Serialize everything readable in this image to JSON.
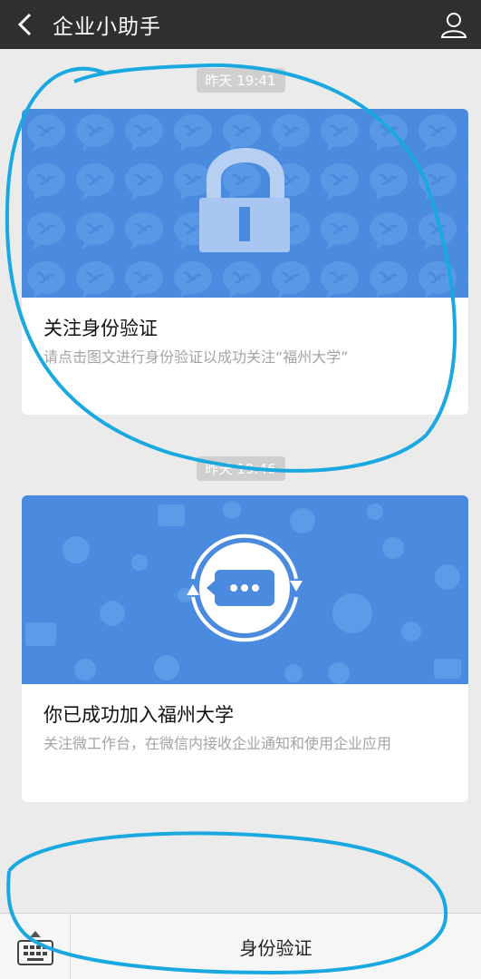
{
  "header": {
    "title": "企业小助手",
    "back_icon": "chevron-left-icon",
    "profile_icon": "person-icon"
  },
  "messages": [
    {
      "timestamp": "昨天 19:41",
      "title": "关注身份验证",
      "description": "请点击图文进行身份验证以成功关注“福州大学”",
      "banner_icon": "lock-icon"
    },
    {
      "timestamp": "昨天 19:46",
      "title": "你已成功加入福州大学",
      "description": "关注微工作台，在微信内接收企业通知和使用企业应用",
      "banner_icon": "chat-bubble-icon"
    }
  ],
  "bottom_bar": {
    "keyboard_icon": "keyboard-icon",
    "menu_label": "身份验证"
  },
  "colors": {
    "header_bg": "#2f2f31",
    "banner_blue": "#4a8be0",
    "annotation_cyan": "#1aa8e0"
  }
}
